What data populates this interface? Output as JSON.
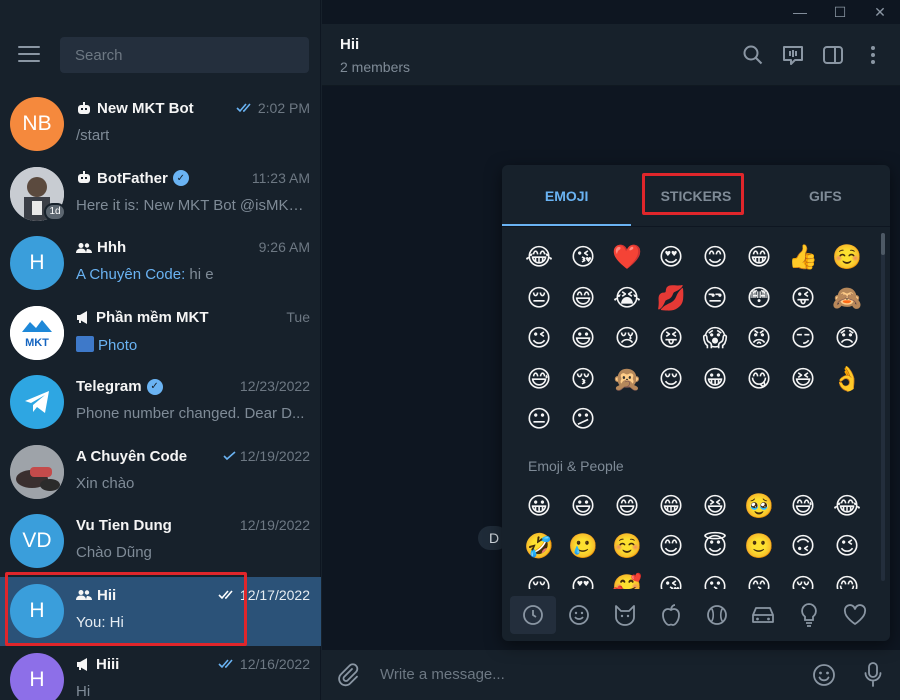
{
  "window": {
    "minimize": "—",
    "maximize": "☐",
    "close": "✕"
  },
  "sidebar": {
    "search_placeholder": "Search",
    "chats": [
      {
        "name": "New MKT Bot",
        "prefix": "bot",
        "time": "2:02 PM",
        "read": true,
        "preview": "/start",
        "avatar_initials": "NB",
        "avatar_color": "#f5893d"
      },
      {
        "name": "BotFather",
        "prefix": "bot",
        "verified": true,
        "time": "11:23 AM",
        "preview": "Here it is: New MKT Bot @isMKT_...",
        "avatar_badge": "1d"
      },
      {
        "name": "Hhh",
        "prefix": "group",
        "time": "9:26 AM",
        "preview_sender": "A Chuyên Code:",
        "preview": " hi e",
        "avatar_initials": "H",
        "avatar_color": "#3a9edb"
      },
      {
        "name": "Phần mềm MKT",
        "prefix": "channel",
        "time": "Tue",
        "preview": "Photo",
        "avatar_logo": "MKT"
      },
      {
        "name": "Telegram",
        "verified": true,
        "time": "12/23/2022",
        "preview": "Phone number changed. Dear D..."
      },
      {
        "name": "A Chuyên Code",
        "time": "12/19/2022",
        "read": true,
        "preview": "Xin chào"
      },
      {
        "name": "Vu Tien Dung",
        "time": "12/19/2022",
        "preview": "Chào Dũng",
        "avatar_initials": "VD",
        "avatar_color": "#3a9edb"
      },
      {
        "name": "Hii",
        "prefix": "group",
        "time": "12/17/2022",
        "read": true,
        "preview": "You: Hi",
        "avatar_initials": "H",
        "avatar_color": "#3a9edb",
        "active": true
      },
      {
        "name": "Hiii",
        "prefix": "channel",
        "time": "12/16/2022",
        "read": true,
        "preview": "Hi",
        "avatar_initials": "H",
        "avatar_color": "#8d6fe8"
      }
    ]
  },
  "header": {
    "title": "Hii",
    "subtitle": "2 members"
  },
  "date_pill": "D",
  "emoji_panel": {
    "tabs": [
      "EMOJI",
      "STICKERS",
      "GIFS"
    ],
    "active_tab": "EMOJI",
    "highlighted_tab": "STICKERS",
    "recent": [
      "😂",
      "😘",
      "❤️",
      "😍",
      "😊",
      "😁",
      "👍",
      "☺️",
      "😔",
      "😄",
      "😭",
      "💋",
      "😒",
      "😳",
      "😜",
      "🙈",
      "😉",
      "😃",
      "😢",
      "😝",
      "😱",
      "😡",
      "😏",
      "😞",
      "😅",
      "😚",
      "🙊",
      "😌",
      "😀",
      "😋",
      "😆",
      "👌",
      "😐",
      "😕"
    ],
    "section_title": "Emoji & People",
    "people": [
      "😀",
      "😃",
      "😄",
      "😁",
      "😆",
      "🥹",
      "😅",
      "😂",
      "🤣",
      "🥲",
      "☺️",
      "😊",
      "😇",
      "🙂",
      "🙃",
      "😉",
      "😌",
      "😍",
      "🥰",
      "😘",
      "😗",
      "😙",
      "😚",
      "😋"
    ],
    "categories": [
      "clock-icon",
      "smile-icon",
      "cat-icon",
      "apple-icon",
      "ball-icon",
      "car-icon",
      "bulb-icon",
      "heart-icon"
    ]
  },
  "composer": {
    "placeholder": "Write a message..."
  },
  "colors": {
    "accent": "#6ab3f3",
    "highlight": "#e0262b",
    "active_chat": "#2b5278"
  }
}
